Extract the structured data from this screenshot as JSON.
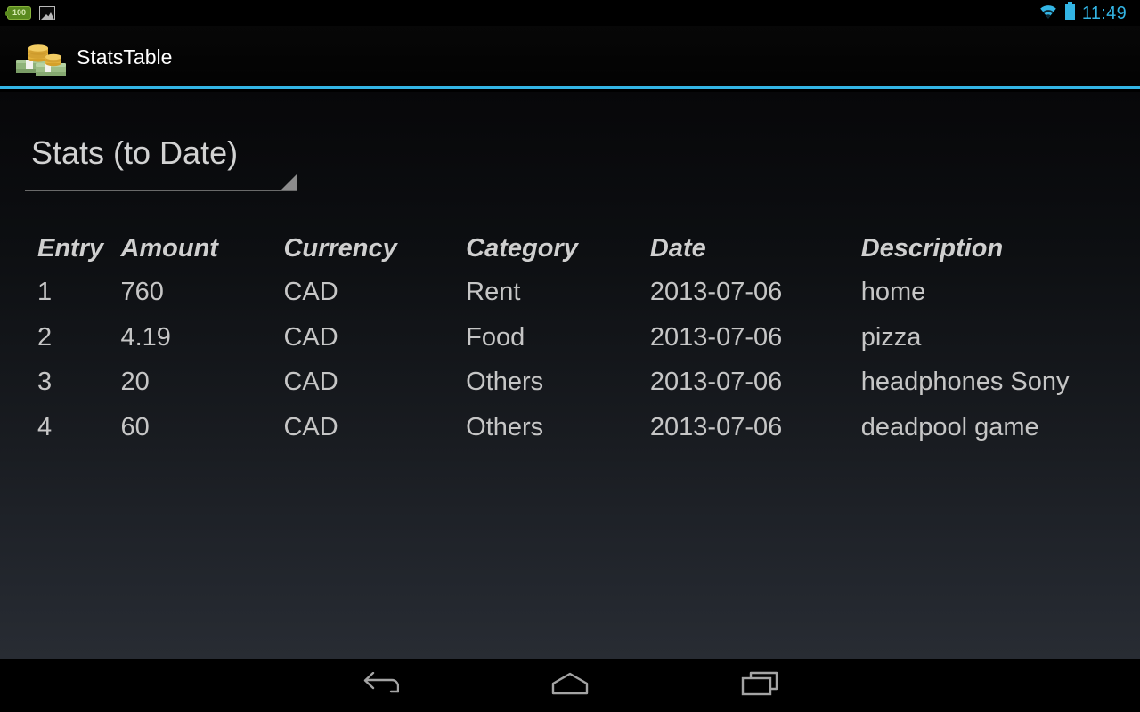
{
  "status_bar": {
    "notification_icons": [
      {
        "name": "battery-100-notification-icon",
        "label": "100"
      },
      {
        "name": "gallery-image-notification-icon",
        "label": ""
      }
    ],
    "wifi_icon": "wifi-icon",
    "battery_icon": "battery-icon",
    "clock": "11:49",
    "accent_color": "#33b5e5"
  },
  "action_bar": {
    "app_icon": "money-stack-icon",
    "title": "StatsTable",
    "divider_color": "#33b5e5"
  },
  "spinner": {
    "selected": "Stats (to Date)",
    "caret_icon": "dropdown-triangle-icon"
  },
  "table": {
    "headers": [
      "Entry",
      "Amount",
      "Currency",
      "Category",
      "Date",
      "Description"
    ],
    "rows": [
      {
        "entry": "1",
        "amount": "760",
        "currency": "CAD",
        "category": "Rent",
        "date": "2013-07-06",
        "description": "home"
      },
      {
        "entry": "2",
        "amount": "4.19",
        "currency": "CAD",
        "category": "Food",
        "date": "2013-07-06",
        "description": "pizza"
      },
      {
        "entry": "3",
        "amount": "20",
        "currency": "CAD",
        "category": "Others",
        "date": "2013-07-06",
        "description": "headphones Sony"
      },
      {
        "entry": "4",
        "amount": "60",
        "currency": "CAD",
        "category": "Others",
        "date": "2013-07-06",
        "description": "deadpool game"
      }
    ]
  },
  "nav_bar": {
    "back": "back-icon",
    "home": "home-icon",
    "recents": "recents-icon"
  }
}
